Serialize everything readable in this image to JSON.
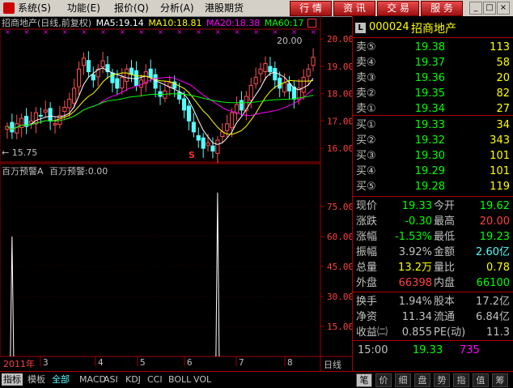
{
  "menu": {
    "items": [
      "系统(S)",
      "功能(E)",
      "报价(Q)",
      "分析(A)",
      "港股期货"
    ],
    "toolbar": [
      "行 情",
      "资 讯",
      "交 易",
      "服 务"
    ]
  },
  "chart": {
    "stock_name": "招商地产(日线,前复权)",
    "ma5": "MA5:19.14",
    "ma10": "MA10:18.81",
    "ma20": "MA20:18.38",
    "ma60": "MA60:17",
    "high_marker": "20.00",
    "low_marker": "← 15.75",
    "s_marker": "S",
    "indicator_title": "百万预警A",
    "indicator_value": "百万预警:0.00",
    "price_ticks": [
      "20.00",
      "19.00",
      "18.00",
      "17.00",
      "16.00"
    ],
    "vol_ticks": [
      "75.00",
      "60.00",
      "45.00",
      "30.00",
      "15.00"
    ],
    "year_label": "2011年",
    "month_labels": [
      "3",
      "4",
      "5",
      "6",
      "7",
      "8"
    ],
    "period_label": "日线",
    "colors": {
      "ma5": "#ffffff",
      "ma10": "#ffff00",
      "ma20": "#ff00ff",
      "ma60": "#00ff00",
      "up": "#ff5050",
      "down": "#54ffff",
      "grid": "#a00000"
    }
  },
  "chart_data": {
    "type": "line",
    "title": "招商地产(日线,前复权)",
    "ylim": [
      15.5,
      20.3
    ],
    "price_series": [
      16.8,
      16.6,
      16.9,
      17.1,
      16.8,
      17.0,
      17.3,
      17.2,
      17.4,
      17.0,
      16.9,
      17.2,
      17.5,
      17.8,
      18.2,
      18.9,
      19.3,
      18.8,
      18.5,
      18.9,
      19.2,
      18.8,
      18.4,
      18.2,
      18.6,
      18.9,
      18.7,
      18.3,
      18.5,
      18.8,
      18.6,
      18.2,
      17.9,
      18.1,
      18.4,
      18.2,
      17.8,
      17.4,
      17.0,
      16.6,
      16.3,
      16.0,
      16.2,
      15.9,
      16.3,
      16.6,
      16.9,
      17.3,
      17.6,
      17.4,
      17.9,
      18.3,
      18.6,
      18.9,
      19.1,
      18.8,
      18.5,
      18.2,
      18.4,
      18.1,
      17.8,
      18.2,
      18.6,
      18.9,
      19.33
    ],
    "indicator_spikes": [
      {
        "index": 1,
        "value": 60
      },
      {
        "index": 44,
        "value": 82
      }
    ]
  },
  "panel": {
    "code": "000024",
    "name": "招商地产",
    "asks": [
      {
        "label": "卖⑤",
        "price": "19.38",
        "qty": "113"
      },
      {
        "label": "卖④",
        "price": "19.37",
        "qty": "58"
      },
      {
        "label": "卖③",
        "price": "19.36",
        "qty": "20"
      },
      {
        "label": "卖②",
        "price": "19.35",
        "qty": "82"
      },
      {
        "label": "卖①",
        "price": "19.34",
        "qty": "27"
      }
    ],
    "bids": [
      {
        "label": "买①",
        "price": "19.33",
        "qty": "34"
      },
      {
        "label": "买②",
        "price": "19.32",
        "qty": "343"
      },
      {
        "label": "买③",
        "price": "19.30",
        "qty": "101"
      },
      {
        "label": "买④",
        "price": "19.29",
        "qty": "101"
      },
      {
        "label": "买⑤",
        "price": "19.28",
        "qty": "119"
      }
    ],
    "stats": [
      {
        "k1": "现价",
        "v1": "19.33",
        "c1": "#00ff00",
        "k2": "今开",
        "v2": "19.62",
        "c2": "#00ff00"
      },
      {
        "k1": "涨跌",
        "v1": "-0.30",
        "c1": "#00ff00",
        "k2": "最高",
        "v2": "20.00",
        "c2": "#ff4040"
      },
      {
        "k1": "涨幅",
        "v1": "-1.53%",
        "c1": "#00ff00",
        "k2": "最低",
        "v2": "19.23",
        "c2": "#00ff00"
      },
      {
        "k1": "振幅",
        "v1": "3.92%",
        "c1": "#c0c0c0",
        "k2": "金额",
        "v2": "2.60亿",
        "c2": "#54ffff"
      },
      {
        "k1": "总量",
        "v1": "13.2万",
        "c1": "#ffff00",
        "k2": "量比",
        "v2": "0.78",
        "c2": "#ffff00"
      },
      {
        "k1": "外盘",
        "v1": "66398",
        "c1": "#ff4040",
        "k2": "内盘",
        "v2": "66100",
        "c2": "#00ff00"
      }
    ],
    "fundamentals": [
      {
        "k1": "换手",
        "v1": "1.94%",
        "k2": "股本",
        "v2": "17.2亿"
      },
      {
        "k1": "净资",
        "v1": "11.34",
        "k2": "流通",
        "v2": "6.84亿"
      },
      {
        "k1": "收益㈡",
        "v1": "0.855",
        "k2": "PE(动)",
        "v2": "11.3"
      }
    ],
    "tick": {
      "time": "15:00",
      "price": "19.33",
      "vol": "735"
    }
  },
  "tabs": {
    "left": [
      "指标",
      "模板",
      "全部",
      "MACD",
      "ASI",
      "KDJ",
      "CCI",
      "BOLL",
      "VOL"
    ],
    "right": [
      "笔",
      "价",
      "细",
      "盘",
      "势",
      "指",
      "值",
      "筹"
    ]
  }
}
